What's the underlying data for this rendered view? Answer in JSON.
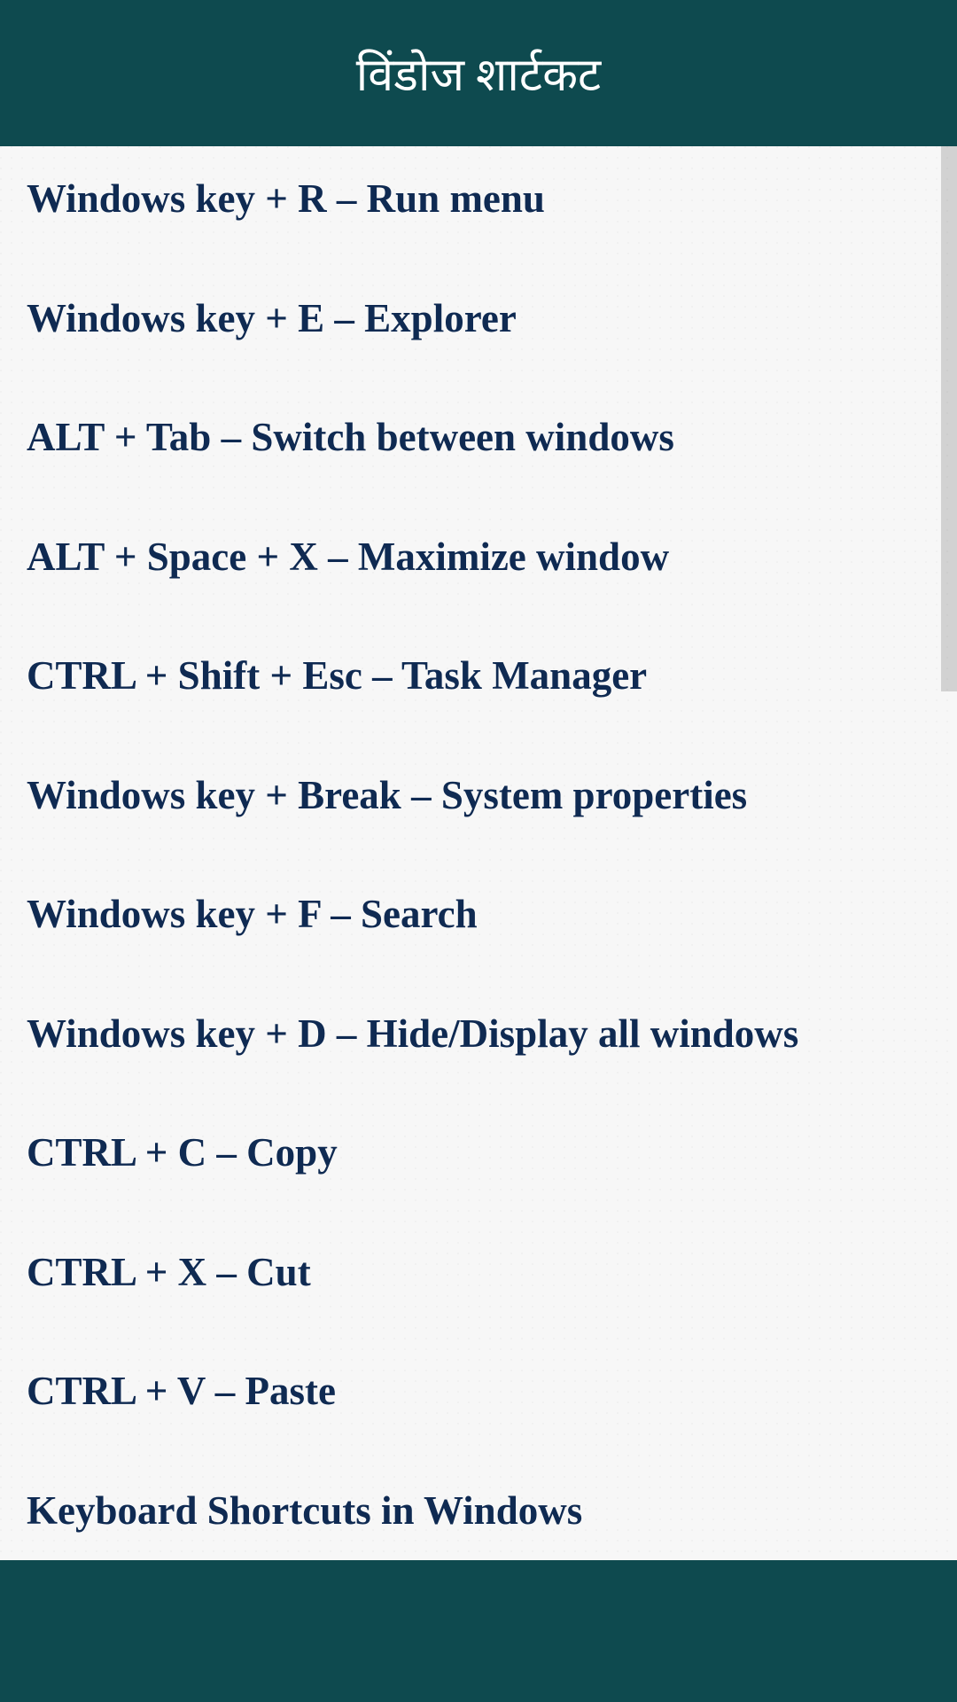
{
  "header": {
    "title": "विंडोज शार्टकट"
  },
  "shortcuts": [
    "Windows key + R – Run menu",
    "Windows key + E – Explorer",
    "ALT + Tab – Switch between windows",
    "ALT + Space + X – Maximize window",
    "CTRL + Shift + Esc – Task Manager",
    "Windows key + Break – System properties",
    "Windows key + F – Search",
    "Windows key + D – Hide/Display all windows",
    "CTRL + C – Copy",
    "CTRL + X – Cut",
    "CTRL + V – Paste",
    "Keyboard Shortcuts in Windows"
  ]
}
